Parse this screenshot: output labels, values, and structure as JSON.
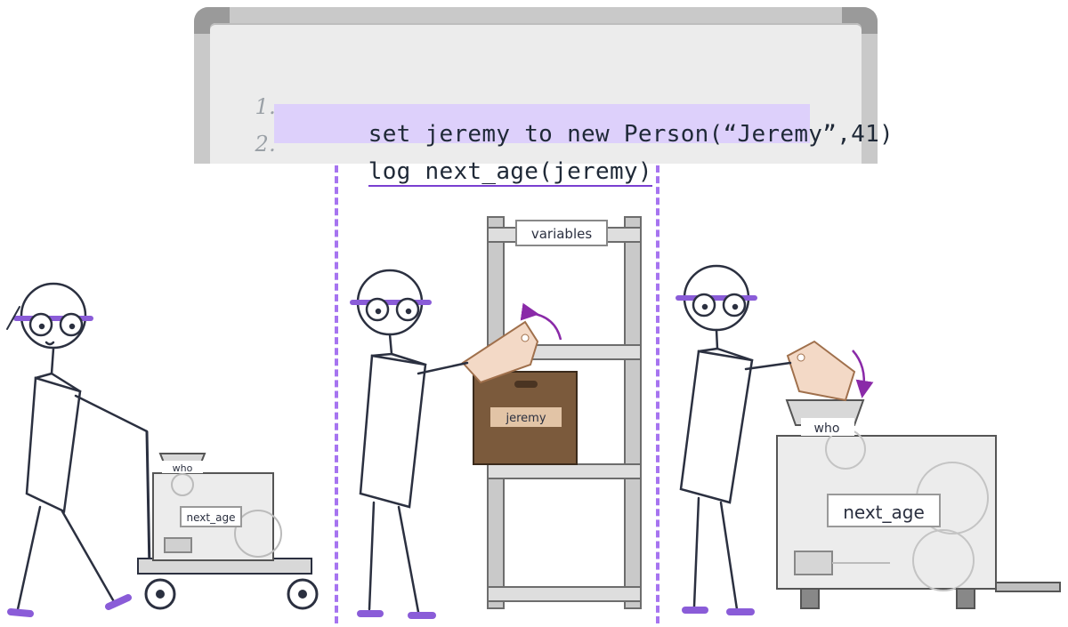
{
  "code": {
    "lines": [
      {
        "number": "1.",
        "text": "set jeremy to new Person(“Jeremy”,41)"
      },
      {
        "number": "2.",
        "text": "log next_age(jeremy)"
      }
    ],
    "highlighted_line": 2
  },
  "labels": {
    "shelf_sign": "variables",
    "box_label": "jeremy",
    "small_hopper": "who",
    "small_machine": "next_age",
    "large_hopper": "who",
    "large_machine": "next_age"
  },
  "colors": {
    "accent": "#a674f0",
    "highlight": "#ddd0fb",
    "box": "#7b5a3c",
    "tag": "#f3d9c6"
  }
}
